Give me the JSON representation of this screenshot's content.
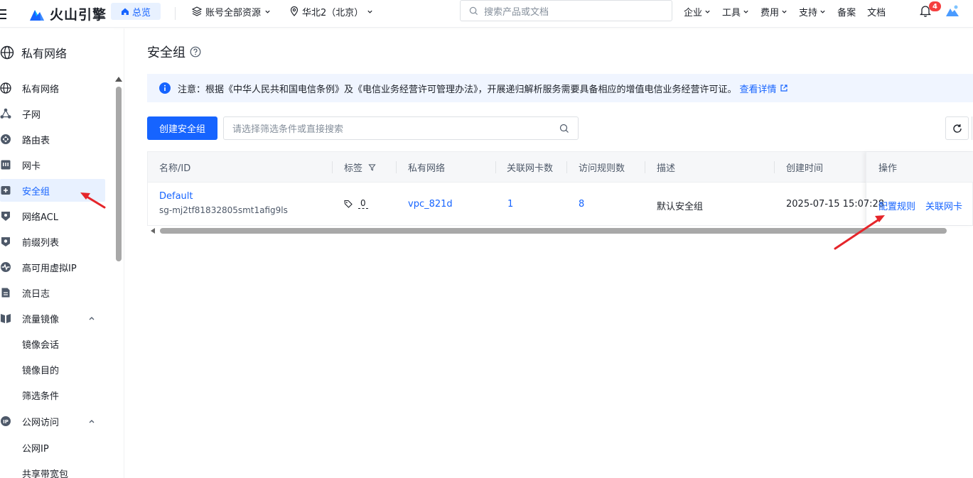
{
  "topbar": {
    "brand": "火山引擎",
    "home_label": "总览",
    "resource_label": "账号全部资源",
    "region_label": "华北2（北京）",
    "search_placeholder": "搜索产品或文档",
    "nav": [
      "企业",
      "工具",
      "费用",
      "支持",
      "备案",
      "文档"
    ],
    "notification_count": "4"
  },
  "sidebar": {
    "title": "私有网络",
    "items": [
      {
        "label": "私有网络",
        "icon": "globe-icon"
      },
      {
        "label": "子网",
        "icon": "subnet-icon"
      },
      {
        "label": "路由表",
        "icon": "route-icon"
      },
      {
        "label": "网卡",
        "icon": "nic-icon"
      },
      {
        "label": "安全组",
        "icon": "security-group-icon",
        "active": true
      },
      {
        "label": "网络ACL",
        "icon": "acl-icon"
      },
      {
        "label": "前缀列表",
        "icon": "prefix-list-icon"
      },
      {
        "label": "高可用虚拟IP",
        "icon": "havip-icon"
      },
      {
        "label": "流日志",
        "icon": "flow-log-icon"
      },
      {
        "label": "流量镜像",
        "icon": "mirror-icon",
        "expanded": true
      },
      {
        "label": "镜像会话",
        "sub": true
      },
      {
        "label": "镜像目的",
        "sub": true
      },
      {
        "label": "筛选条件",
        "sub": true
      },
      {
        "label": "公网访问",
        "icon": "public-ip-icon",
        "expanded": true
      },
      {
        "label": "公网IP",
        "sub": true
      },
      {
        "label": "共享带宽包",
        "sub": true
      }
    ]
  },
  "main": {
    "title": "安全组",
    "notice_text": "注意：根据《中华人民共和国电信条例》及《电信业务经营许可管理办法》，开展递归解析服务需要具备相应的增值电信业务经营许可证。",
    "notice_link": "查看详情",
    "create_button": "创建安全组",
    "filter_placeholder": "请选择筛选条件或直接搜索",
    "table": {
      "headers": [
        "名称/ID",
        "标签",
        "私有网络",
        "关联网卡数",
        "访问规则数",
        "描述",
        "创建时间",
        "操作"
      ],
      "rows": [
        {
          "name": "Default",
          "id": "sg-mj2tf81832805smt1afig9ls",
          "tags": "0",
          "vpc": "vpc_821d",
          "nic_count": "1",
          "rule_count": "8",
          "description": "默认安全组",
          "created": "2025-07-15 15:07:28",
          "actions": [
            "配置规则",
            "关联网卡"
          ]
        }
      ]
    }
  },
  "colors": {
    "accent": "#1664ff",
    "annotation_arrow": "#e5252a"
  }
}
